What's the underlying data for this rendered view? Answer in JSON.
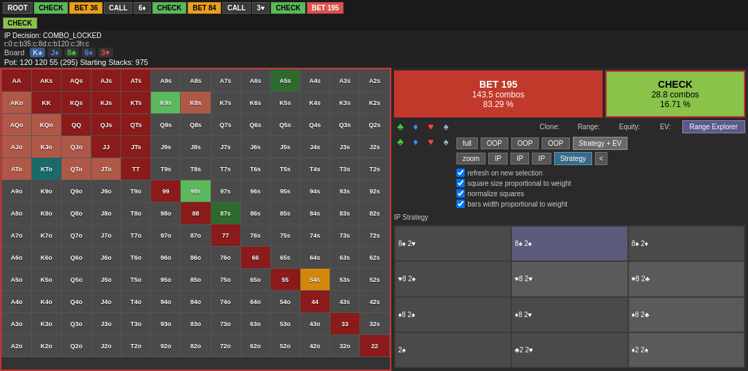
{
  "topNav": {
    "items": [
      {
        "label": "ROOT",
        "style": "default"
      },
      {
        "label": "CHECK",
        "style": "active-green"
      },
      {
        "label": "BET 36",
        "style": "active-orange"
      },
      {
        "label": "CALL",
        "style": "default"
      },
      {
        "label": "6♦",
        "style": "default"
      },
      {
        "label": "CHECK",
        "style": "active-green"
      },
      {
        "label": "BET 84",
        "style": "active-orange"
      },
      {
        "label": "CALL",
        "style": "default"
      },
      {
        "label": "3♥",
        "style": "default"
      },
      {
        "label": "CHECK",
        "style": "active-green"
      },
      {
        "label": "BET 195",
        "style": "active-red"
      }
    ]
  },
  "secondNav": {
    "items": [
      {
        "label": "CHECK",
        "style": "active-check-green"
      }
    ]
  },
  "infoBar": {
    "ipDecision": "IP Decision: COMBO_LOCKED",
    "rLine": "r:0:c:b35:c:8d:c:b120:c:3h:c",
    "boardLabel": "Board",
    "boardCards": [
      {
        "label": "K♠",
        "suit": "spade"
      },
      {
        "label": "J♦",
        "suit": "diamond"
      },
      {
        "label": "8♣",
        "suit": "club-g"
      },
      {
        "label": "6♦",
        "suit": "diamond"
      },
      {
        "label": "3♥",
        "suit": "heart"
      }
    ],
    "potLine": "Pot: 120  120  55  (295)  Starting Stacks: 975"
  },
  "actionBoxes": {
    "bet": {
      "title": "BET 195",
      "combos": "143.5 combos",
      "pct": "83.29 %"
    },
    "check": {
      "title": "CHECK",
      "combos": "28.8 combos",
      "pct": "16.71 %"
    }
  },
  "controls": {
    "cloneLabel": "Clone:",
    "rangeLabel": "Range:",
    "equityLabel": "Equity:",
    "evLabel": "EV:",
    "rangeExplorerBtn": "Range Explorer",
    "fullBtn": "full",
    "zoomBtn": "zoom",
    "oopBtn1": "OOP",
    "oopBtn2": "OOP",
    "oopBtn3": "OOP",
    "ipBtn1": "IP",
    "ipBtn2": "IP",
    "ipBtn3": "IP",
    "strategyEvBtn": "Strategy + EV",
    "strategyBtn": "Strategy",
    "arrowBtn": "<"
  },
  "checkboxes": [
    {
      "label": "refresh on new selection",
      "checked": true
    },
    {
      "label": "square size proportional to weight",
      "checked": true
    },
    {
      "label": "normalize squares",
      "checked": true
    },
    {
      "label": "bars width proportional to weight",
      "checked": true
    }
  ],
  "ipStrategyLabel": "IP Strategy",
  "cardGrid": [
    [
      {
        "cards": "8♠ 2♥",
        "suit1": "spade",
        "suit2": "heart"
      },
      {
        "cards": "8♠ 2♠",
        "suit1": "spade",
        "suit2": "spade"
      },
      {
        "cards": "8♠ 2♦",
        "suit1": "spade",
        "suit2": "diamond"
      }
    ],
    [
      {
        "cards": "♥ 2♠",
        "suit1": "heart",
        "suit2": "spade"
      },
      {
        "cards": "♥ 2♥",
        "suit1": "heart",
        "suit2": "heart"
      },
      {
        "cards": "♥ 2♣",
        "suit1": "heart",
        "suit2": "club"
      }
    ],
    [
      {
        "cards": "♦ 2♠",
        "suit1": "diamond",
        "suit2": "spade"
      },
      {
        "cards": "♦ 2♥",
        "suit1": "diamond",
        "suit2": "heart"
      },
      {
        "cards": "♦ 2♣",
        "suit1": "diamond",
        "suit2": "club"
      }
    ],
    [
      {
        "cards": "2♠",
        "suit1": "spade",
        "suit2": ""
      },
      {
        "cards": "2♣ 2♥",
        "suit1": "club",
        "suit2": "heart"
      },
      {
        "cards": "2♦ 2♠",
        "suit1": "diamond",
        "suit2": "spade"
      }
    ]
  ],
  "grid": {
    "cells": [
      [
        "AA",
        "AKs",
        "AQs",
        "AJs",
        "ATs",
        "A9s",
        "A8s",
        "A7s",
        "A6s",
        "A5s",
        "A4s",
        "A3s",
        "A2s"
      ],
      [
        "AKo",
        "KK",
        "KQs",
        "KJs",
        "KTs",
        "K9s",
        "K8s",
        "K7s",
        "K6s",
        "K5s",
        "K4s",
        "K3s",
        "K2s"
      ],
      [
        "AQo",
        "KQo",
        "QQ",
        "QJs",
        "QTs",
        "Q9s",
        "Q8s",
        "Q7s",
        "Q6s",
        "Q5s",
        "Q4s",
        "Q3s",
        "Q2s"
      ],
      [
        "AJo",
        "KJo",
        "QJo",
        "JJ",
        "JTs",
        "J9s",
        "J8s",
        "J7s",
        "J6s",
        "J5s",
        "J4s",
        "J3s",
        "J2s"
      ],
      [
        "ATo",
        "KTo",
        "QTo",
        "JTo",
        "TT",
        "T9s",
        "T8s",
        "T7s",
        "T6s",
        "T5s",
        "T4s",
        "T3s",
        "T2s"
      ],
      [
        "A9o",
        "K9o",
        "Q9o",
        "J9o",
        "T9o",
        "99",
        "98s",
        "97s",
        "96s",
        "95s",
        "94s",
        "93s",
        "92s"
      ],
      [
        "A8o",
        "K8o",
        "Q8o",
        "J8o",
        "T8o",
        "98o",
        "88",
        "87s",
        "86s",
        "85s",
        "84s",
        "83s",
        "82s"
      ],
      [
        "A7o",
        "K7o",
        "Q7o",
        "J7o",
        "T7o",
        "97o",
        "87o",
        "77",
        "76s",
        "75s",
        "74s",
        "73s",
        "72s"
      ],
      [
        "A6o",
        "K6o",
        "Q6o",
        "J6o",
        "T6o",
        "96o",
        "86o",
        "76o",
        "66",
        "65s",
        "64s",
        "63s",
        "62s"
      ],
      [
        "A5o",
        "K5o",
        "Q5o",
        "J5o",
        "T5o",
        "95o",
        "85o",
        "75o",
        "65o",
        "55",
        "54s",
        "53s",
        "52s"
      ],
      [
        "A4o",
        "K4o",
        "Q4o",
        "J4o",
        "T4o",
        "94o",
        "84o",
        "74o",
        "64o",
        "54o",
        "44",
        "43s",
        "42s"
      ],
      [
        "A3o",
        "K3o",
        "Q3o",
        "J3o",
        "T3o",
        "93o",
        "83o",
        "73o",
        "63o",
        "53o",
        "43o",
        "33",
        "32s"
      ],
      [
        "A2o",
        "K2o",
        "Q2o",
        "J2o",
        "T2o",
        "92o",
        "82o",
        "72o",
        "62o",
        "52o",
        "42o",
        "32o",
        "22"
      ]
    ],
    "colors": [
      [
        "red-dark",
        "red-dark",
        "red-dark",
        "red-dark",
        "red-dark",
        "default",
        "default",
        "default",
        "default",
        "green-dark",
        "default",
        "default",
        "default"
      ],
      [
        "salmon",
        "red-dark",
        "red-dark",
        "red-dark",
        "red-dark",
        "green-light",
        "salmon",
        "default",
        "default",
        "default",
        "default",
        "default",
        "default"
      ],
      [
        "salmon",
        "salmon",
        "red-dark",
        "red-dark",
        "red-dark",
        "default",
        "default",
        "default",
        "default",
        "default",
        "default",
        "default",
        "default"
      ],
      [
        "salmon",
        "salmon",
        "salmon",
        "red-dark",
        "red-dark",
        "default",
        "default",
        "default",
        "default",
        "default",
        "default",
        "default",
        "default"
      ],
      [
        "salmon",
        "teal",
        "salmon",
        "salmon",
        "red-dark",
        "default",
        "default",
        "default",
        "default",
        "default",
        "default",
        "default",
        "default"
      ],
      [
        "default",
        "default",
        "default",
        "default",
        "default",
        "red-dark",
        "green-light",
        "default",
        "default",
        "default",
        "default",
        "default",
        "default"
      ],
      [
        "default",
        "default",
        "default",
        "default",
        "default",
        "default",
        "red-dark",
        "green-dark",
        "default",
        "default",
        "default",
        "default",
        "default"
      ],
      [
        "default",
        "default",
        "default",
        "default",
        "default",
        "default",
        "default",
        "red-dark",
        "default",
        "default",
        "default",
        "default",
        "default"
      ],
      [
        "default",
        "default",
        "default",
        "default",
        "default",
        "default",
        "default",
        "default",
        "red-dark",
        "default",
        "default",
        "default",
        "default"
      ],
      [
        "default",
        "default",
        "default",
        "default",
        "default",
        "default",
        "default",
        "default",
        "default",
        "red-dark",
        "orange",
        "default",
        "default"
      ],
      [
        "default",
        "default",
        "default",
        "default",
        "default",
        "default",
        "default",
        "default",
        "default",
        "default",
        "red-dark",
        "default",
        "default"
      ],
      [
        "default",
        "default",
        "default",
        "default",
        "default",
        "default",
        "default",
        "default",
        "default",
        "default",
        "default",
        "red-dark",
        "default"
      ],
      [
        "default",
        "default",
        "default",
        "default",
        "default",
        "default",
        "default",
        "default",
        "default",
        "default",
        "default",
        "default",
        "red-dark"
      ]
    ]
  }
}
